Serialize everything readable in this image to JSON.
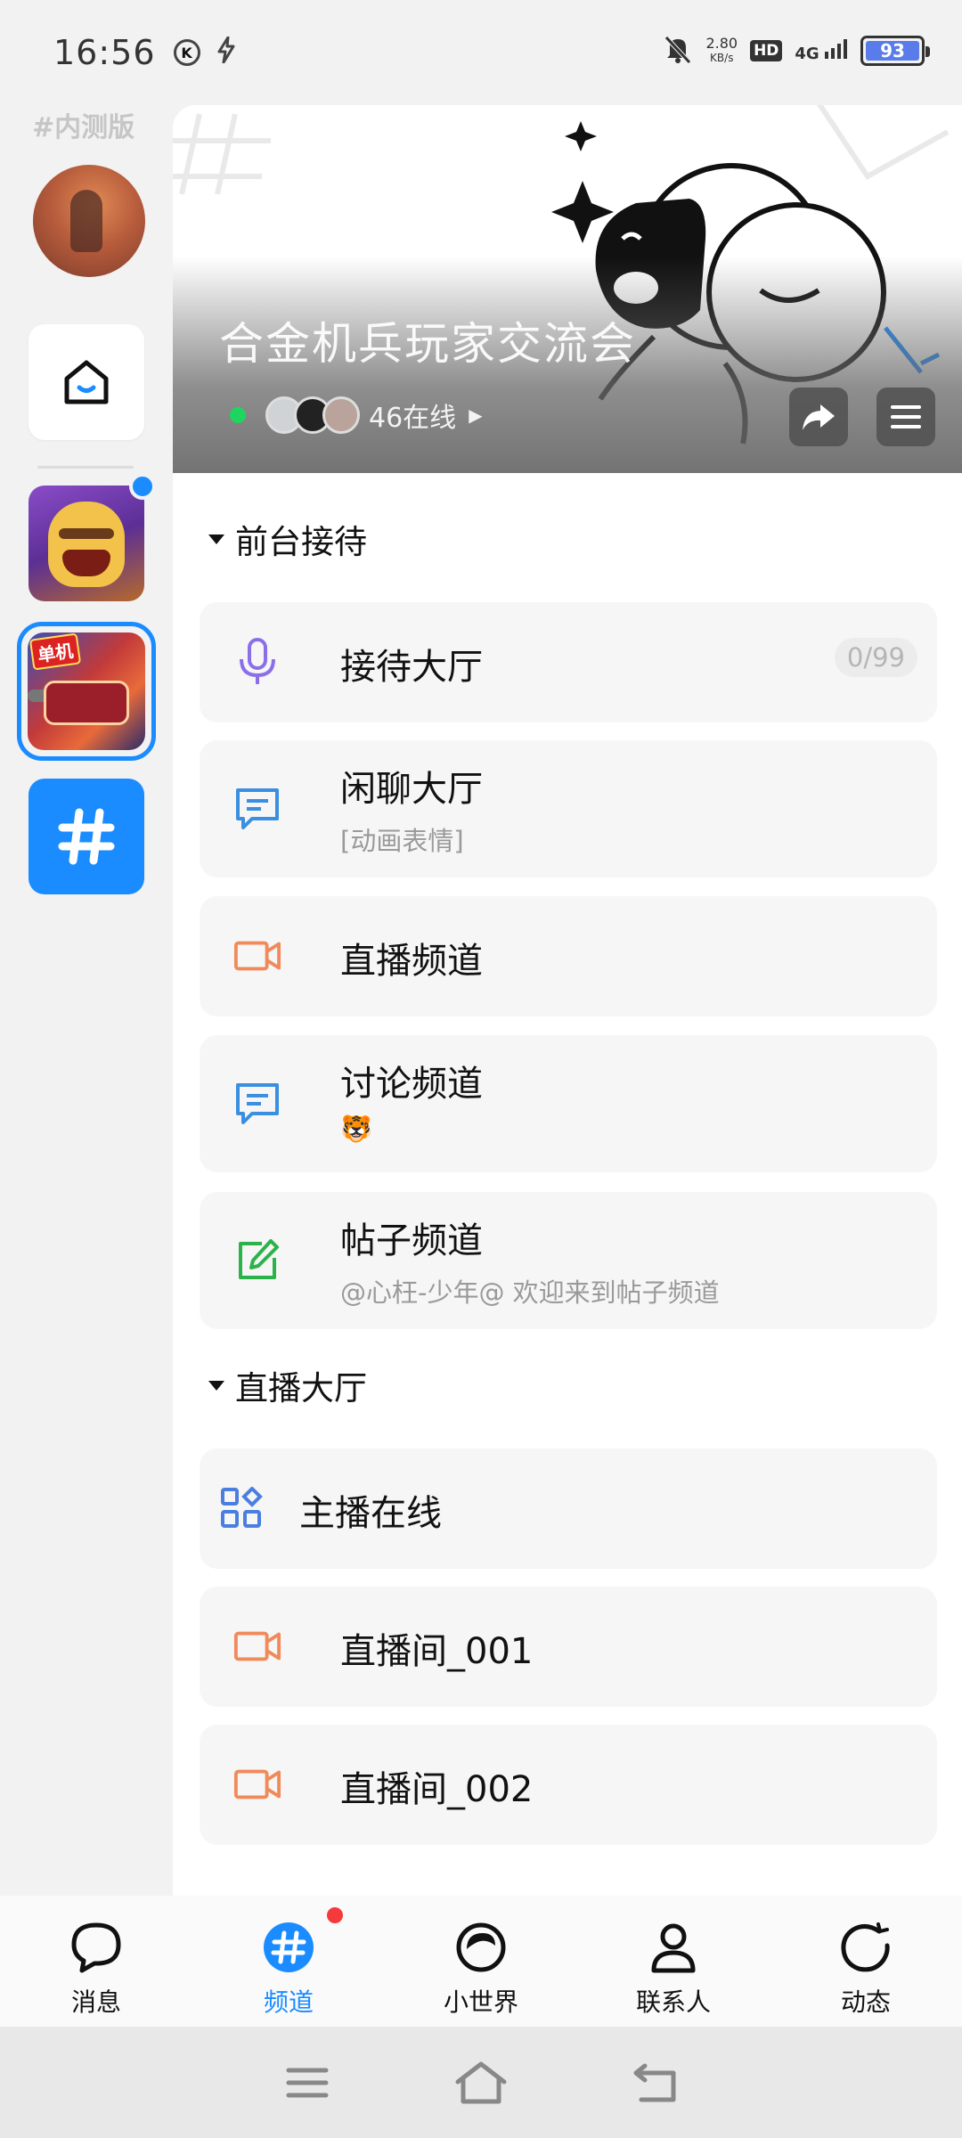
{
  "status_bar": {
    "time": "16:56",
    "k_badge": "K",
    "net_speed_value": "2.80",
    "net_speed_unit": "KB/s",
    "hd": "HD",
    "signal": "4G",
    "battery": "93"
  },
  "rail": {
    "tag": "#内测版",
    "game_badge": "单机"
  },
  "banner": {
    "title": "合金机兵玩家交流会",
    "online": "46在线"
  },
  "sections": [
    {
      "label": "前台接待",
      "channels": [
        {
          "title": "接待大厅",
          "count": "0/99",
          "icon": "microphone-icon"
        },
        {
          "title": "闲聊大厅",
          "subtitle": "[动画表情]",
          "icon": "chat-icon"
        },
        {
          "title": "直播频道",
          "icon": "video-camera-icon"
        },
        {
          "title": "讨论频道",
          "subtitle": "🐯",
          "icon": "chat-icon"
        },
        {
          "title": "帖子频道",
          "subtitle": "@心枉-少年@ 欢迎来到帖子频道",
          "icon": "edit-post-icon"
        }
      ]
    },
    {
      "label": "直播大厅",
      "channels": [
        {
          "title": "主播在线",
          "icon": "apps-grid-icon"
        },
        {
          "title": "直播间_001",
          "icon": "video-camera-icon"
        },
        {
          "title": "直播间_002",
          "icon": "video-camera-icon"
        }
      ]
    }
  ],
  "bottom_nav": [
    {
      "label": "消息",
      "icon": "message-bubble-icon"
    },
    {
      "label": "频道",
      "icon": "channel-hash-icon",
      "active": true
    },
    {
      "label": "小世界",
      "icon": "small-world-icon"
    },
    {
      "label": "联系人",
      "icon": "contacts-icon"
    },
    {
      "label": "动态",
      "icon": "feed-refresh-icon"
    }
  ],
  "colors": {
    "accent": "#1a8cff",
    "online_green": "#1ed65f",
    "mic_purple": "#8b6fe8",
    "chat_blue": "#3a8fe0",
    "video_orange": "#f08a5a",
    "post_green": "#2bb34a",
    "grid_blue": "#4a7fe0",
    "badge_red": "#f43a3a"
  }
}
